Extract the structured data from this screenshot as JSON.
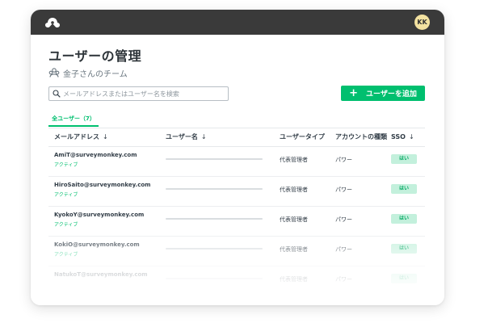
{
  "header": {
    "avatar_initials": "KK",
    "bar_color": "#3a3a3a",
    "logo_icon": "surveymonkey-logo-icon"
  },
  "page": {
    "title": "ユーザーの管理",
    "team_label": "金子さんのチーム",
    "team_icon": "team-icon"
  },
  "search": {
    "placeholder": "メールアドレスまたはユーザー名を検索",
    "value": "",
    "icon": "search-icon"
  },
  "add_button": {
    "label": "ユーザーを追加",
    "icon": "plus-icon",
    "color": "#00bf6f"
  },
  "tabs": [
    {
      "label": "全ユーザー（7）",
      "active": true
    }
  ],
  "table": {
    "columns": [
      {
        "label": "メールアドレス",
        "sortable": true
      },
      {
        "label": "ユーザー名",
        "sortable": true
      },
      {
        "label": "ユーザータイプ",
        "sortable": false
      },
      {
        "label": "アカウントの種類",
        "sortable": false
      },
      {
        "label": "SSO",
        "sortable": true
      }
    ],
    "rows": [
      {
        "email": "AmiT@surveymonkey.com",
        "status": "アクティブ",
        "role": "代表管理者",
        "account": "パワー",
        "sso": "はい"
      },
      {
        "email": "HiroSaito@surveymonkey.com",
        "status": "アクティブ",
        "role": "代表管理者",
        "account": "パワー",
        "sso": "はい"
      },
      {
        "email": "KyokoY@surveymonkey.com",
        "status": "アクティブ",
        "role": "代表管理者",
        "account": "パワー",
        "sso": "はい"
      },
      {
        "email": "KokiO@surveymonkey.com",
        "status": "アクティブ",
        "role": "代表管理者",
        "account": "パワー",
        "sso": "はい"
      },
      {
        "email": "NatukoT@surveymonkey.com",
        "status": "",
        "role": "代表管理者",
        "account": "パワー",
        "sso": "はい"
      }
    ]
  },
  "colors": {
    "accent": "#00bf6f",
    "sso_badge_bg": "#c3f0dc",
    "avatar_bg": "#f3e2a1"
  }
}
